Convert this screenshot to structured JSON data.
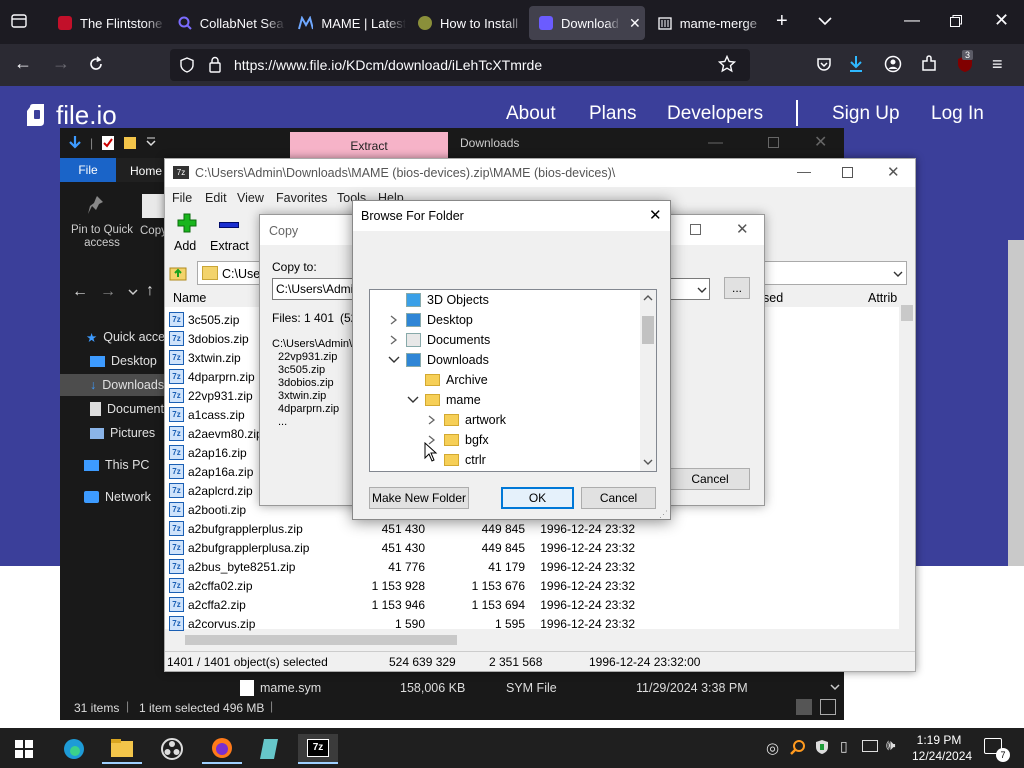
{
  "browser": {
    "tabs": [
      {
        "label": "The Flintstone",
        "icon": "netflix-icon"
      },
      {
        "label": "CollabNet Sea",
        "icon": "search-icon"
      },
      {
        "label": "MAME | Latest",
        "icon": "mame-icon"
      },
      {
        "label": "How to Install",
        "icon": "site-icon"
      },
      {
        "label": "Download",
        "icon": "fileio-icon"
      },
      {
        "label": "mame-merge",
        "icon": "archive-icon"
      }
    ],
    "url": "https://www.file.io/KDcm/download/iLehTcXTmrde",
    "extension_badge": "3"
  },
  "site": {
    "logo": "file.io",
    "nav": [
      "About",
      "Plans",
      "Developers",
      "Sign Up",
      "Log In"
    ]
  },
  "explorer": {
    "ribbon_tabs": {
      "extract": "Extract",
      "file": "File",
      "home": "Home"
    },
    "window_title": "Downloads",
    "ribbon_pin": "Pin to Quick access",
    "ribbon_copy": "Copy",
    "sidebar": [
      "Quick access",
      "Desktop",
      "Downloads",
      "Documents",
      "Pictures",
      "This PC",
      "Network"
    ],
    "status": {
      "items": "31 items",
      "selected": "1 item selected  496 MB"
    },
    "behind_row": {
      "name": "mame.sym",
      "size": "158,006 KB",
      "type": "SYM File",
      "date": "11/29/2024 3:38 PM"
    }
  },
  "zip": {
    "title": "C:\\Users\\Admin\\Downloads\\MAME (bios-devices).zip\\MAME (bios-devices)\\",
    "menu": [
      "File",
      "Edit",
      "View",
      "Favorites",
      "Tools",
      "Help"
    ],
    "toolbar": {
      "add": "Add",
      "extract": "Extract"
    },
    "path": "C:\\Users",
    "columns": {
      "name": "Name",
      "packed": "sed",
      "attr": "Attrib"
    },
    "files": [
      {
        "name": "3c505.zip",
        "size": "",
        "packed": "",
        "date": ""
      },
      {
        "name": "3dobios.zip",
        "size": "",
        "packed": "",
        "date": ""
      },
      {
        "name": "3xtwin.zip",
        "size": "",
        "packed": "",
        "date": ""
      },
      {
        "name": "4dparprn.zip",
        "size": "",
        "packed": "",
        "date": ""
      },
      {
        "name": "22vp931.zip",
        "size": "",
        "packed": "",
        "date": ""
      },
      {
        "name": "a1cass.zip",
        "size": "",
        "packed": "",
        "date": ""
      },
      {
        "name": "a2aevm80.zip",
        "size": "",
        "packed": "",
        "date": ""
      },
      {
        "name": "a2ap16.zip",
        "size": "",
        "packed": "",
        "date": ""
      },
      {
        "name": "a2ap16a.zip",
        "size": "",
        "packed": "",
        "date": ""
      },
      {
        "name": "a2aplcrd.zip",
        "size": "",
        "packed": "",
        "date": ""
      },
      {
        "name": "a2booti.zip",
        "size": "",
        "packed": "",
        "date": ""
      },
      {
        "name": "a2bufgrapplerplus.zip",
        "size": "451 430",
        "packed": "449 845",
        "date": "1996-12-24 23:32"
      },
      {
        "name": "a2bufgrapplerplusa.zip",
        "size": "451 430",
        "packed": "449 845",
        "date": "1996-12-24 23:32"
      },
      {
        "name": "a2bus_byte8251.zip",
        "size": "41 776",
        "packed": "41 179",
        "date": "1996-12-24 23:32"
      },
      {
        "name": "a2cffa02.zip",
        "size": "1 153 928",
        "packed": "1 153 676",
        "date": "1996-12-24 23:32"
      },
      {
        "name": "a2cffa2.zip",
        "size": "1 153 946",
        "packed": "1 153 694",
        "date": "1996-12-24 23:32"
      },
      {
        "name": "a2corvus.zip",
        "size": "1 590",
        "packed": "1 595",
        "date": "1996-12-24 23:32"
      }
    ],
    "status": {
      "selected": "1401 / 1401 object(s) selected",
      "size": "524 639 329",
      "packed": "2 351 568",
      "date": "1996-12-24 23:32:00"
    }
  },
  "copy_dialog": {
    "title": "Copy",
    "copy_to_label": "Copy to:",
    "copy_to_value": "C:\\Users\\Admin\\",
    "files_label": "Files: 1 401",
    "files_suffix": "(52",
    "path_line": "C:\\Users\\Admin\\",
    "file_list": [
      "22vp931.zip",
      "3c505.zip",
      "3dobios.zip",
      "3xtwin.zip",
      "4dparprn.zip",
      "..."
    ],
    "browse_button": "...",
    "cancel_button": "Cancel"
  },
  "browse_dialog": {
    "title": "Browse For Folder",
    "tree": [
      {
        "label": "3D Objects",
        "icon": "3d-objects-icon",
        "level": 1,
        "toggle": ""
      },
      {
        "label": "Desktop",
        "icon": "desktop-icon",
        "level": 1,
        "toggle": ">"
      },
      {
        "label": "Documents",
        "icon": "documents-icon",
        "level": 1,
        "toggle": ">"
      },
      {
        "label": "Downloads",
        "icon": "downloads-icon",
        "level": 1,
        "toggle": "v"
      },
      {
        "label": "Archive",
        "icon": "folder-icon",
        "level": 2,
        "toggle": ""
      },
      {
        "label": "mame",
        "icon": "folder-icon",
        "level": 2,
        "toggle": "v"
      },
      {
        "label": "artwork",
        "icon": "folder-icon",
        "level": 3,
        "toggle": ">"
      },
      {
        "label": "bgfx",
        "icon": "folder-icon",
        "level": 3,
        "toggle": ">"
      },
      {
        "label": "ctrlr",
        "icon": "folder-icon",
        "level": 3,
        "toggle": ""
      }
    ],
    "buttons": {
      "new_folder": "Make New Folder",
      "ok": "OK",
      "cancel": "Cancel"
    }
  },
  "taskbar": {
    "time": "1:19 PM",
    "date": "12/24/2024",
    "notification_count": "7",
    "apps": [
      "edge-icon",
      "file-explorer-icon",
      "obs-icon",
      "firefox-icon",
      "notepad-icon",
      "7zip-icon"
    ]
  },
  "colors": {
    "site_bg": "#3b3f9a",
    "accent": "#0078d7",
    "firefox_dark": "#1c1b22"
  }
}
